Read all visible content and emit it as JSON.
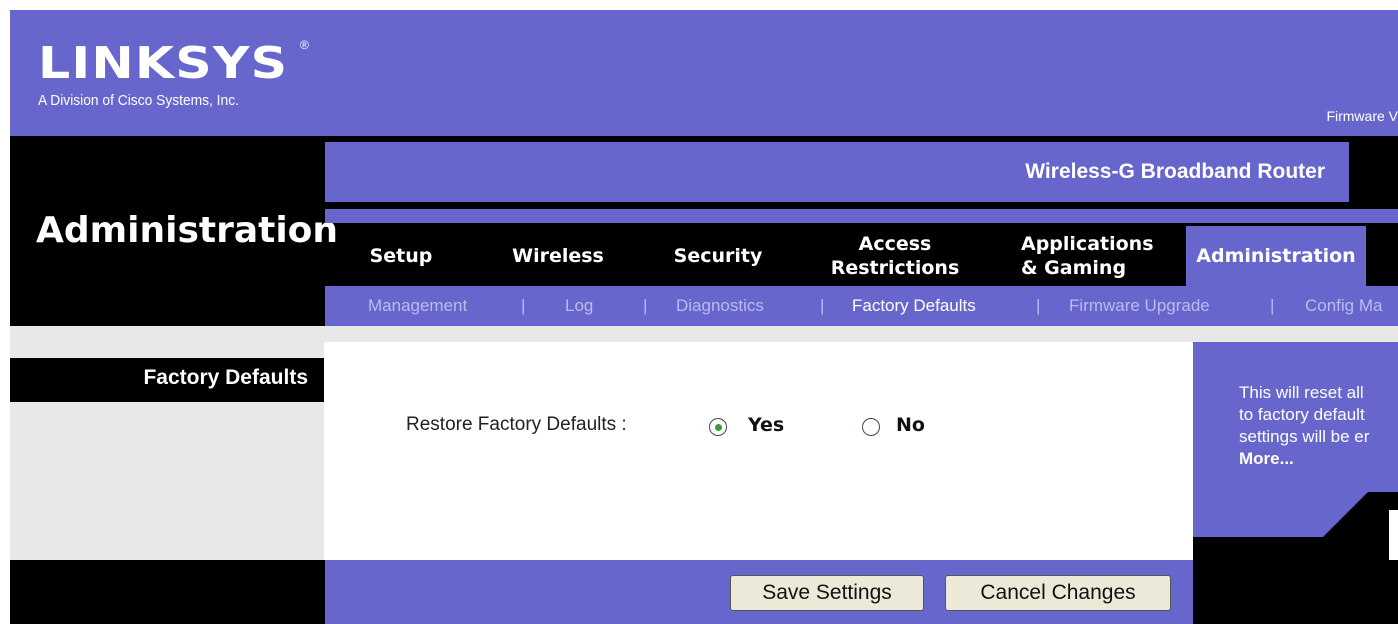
{
  "brand": {
    "logo_text": "LINKSYS",
    "registered_mark": "®",
    "division": "A Division of Cisco Systems, Inc.",
    "firmware_partial": "Firmware V"
  },
  "product_name": "Wireless-G Broadband Router",
  "page_title": "Administration",
  "tabs": [
    {
      "label": "Setup"
    },
    {
      "label": "Wireless"
    },
    {
      "label": "Security"
    },
    {
      "label": "Access\nRestrictions"
    },
    {
      "label": "Applications\n& Gaming"
    },
    {
      "label": "Administration",
      "active": true
    }
  ],
  "subnav": {
    "items": [
      "Management",
      "Log",
      "Diagnostics",
      "Factory Defaults",
      "Firmware Upgrade",
      "Config Ma"
    ],
    "separator": "|",
    "current": "Factory Defaults"
  },
  "section_label": "Factory Defaults",
  "form": {
    "restore_label": "Restore Factory Defaults :",
    "options": [
      {
        "label": "Yes",
        "selected": true
      },
      {
        "label": "No",
        "selected": false
      }
    ]
  },
  "help": {
    "lines": [
      "This will reset all",
      "to factory default",
      "settings will be er"
    ],
    "more_label": "More..."
  },
  "buttons": {
    "save": "Save Settings",
    "cancel": "Cancel Changes"
  },
  "colors": {
    "brand_purple": "#6666cc",
    "black": "#000000",
    "inactive_subnav": "#bbbbee"
  }
}
